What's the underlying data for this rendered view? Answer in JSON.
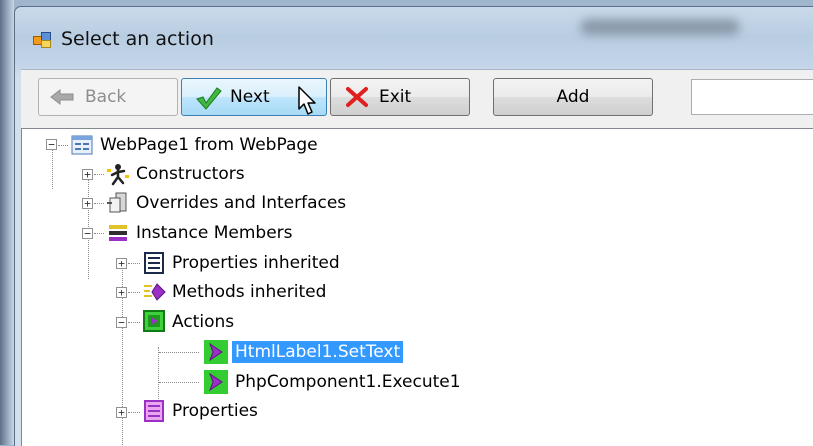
{
  "window": {
    "title": "Select an action"
  },
  "toolbar": {
    "back_label": "Back",
    "next_label": "Next",
    "exit_label": "Exit",
    "add_label": "Add",
    "search_value": ""
  },
  "tree": {
    "root": "WebPage1 from WebPage",
    "constructors": "Constructors",
    "overrides": "Overrides and Interfaces",
    "instance_members": "Instance Members",
    "properties_inherited": "Properties inherited",
    "methods_inherited": "Methods inherited",
    "actions": "Actions",
    "action_1": "HtmlLabel1.SetText",
    "action_2": "PhpComponent1.Execute1",
    "properties": "Properties"
  },
  "colors": {
    "selection": "#3399ff",
    "accent_green": "#33cc33",
    "accent_purple": "#9b30c7"
  }
}
